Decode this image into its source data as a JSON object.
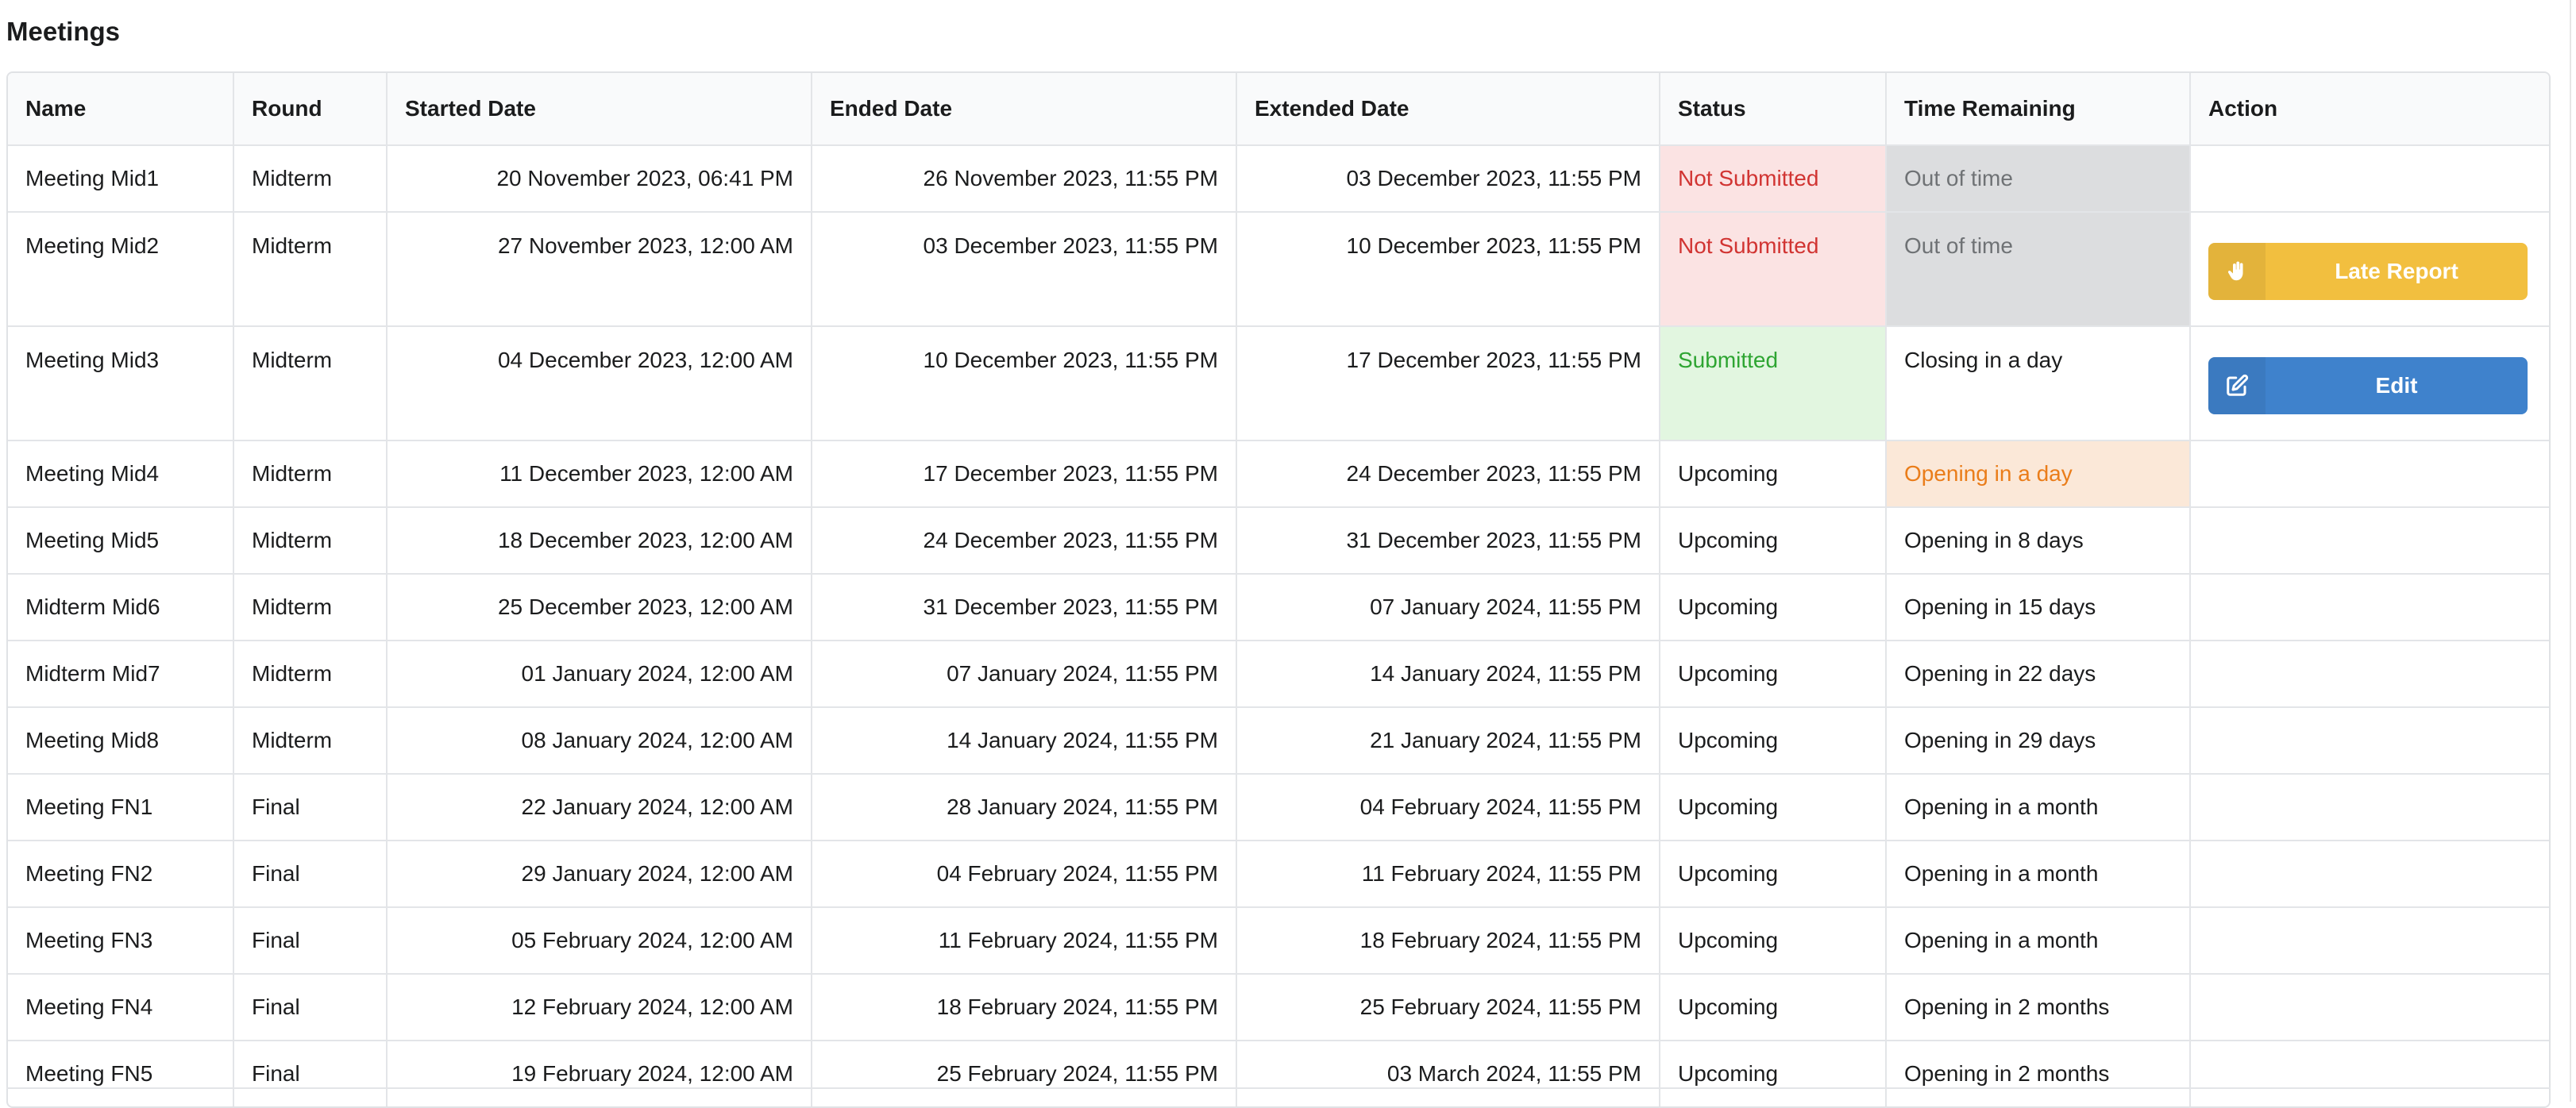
{
  "page": {
    "title": "Meetings"
  },
  "table": {
    "headers": [
      "Name",
      "Round",
      "Started Date",
      "Ended Date",
      "Extended Date",
      "Status",
      "Time Remaining",
      "Action"
    ],
    "rows": [
      {
        "name": "Meeting Mid1",
        "round": "Midterm",
        "started": "20 November 2023, 06:41 PM",
        "ended": "26 November 2023, 11:55 PM",
        "extended": "03 December 2023, 11:55 PM",
        "status": "Not Submitted",
        "time_remaining": "Out of time",
        "action": ""
      },
      {
        "name": "Meeting Mid2",
        "round": "Midterm",
        "started": "27 November 2023, 12:00 AM",
        "ended": "03 December 2023, 11:55 PM",
        "extended": "10 December 2023, 11:55 PM",
        "status": "Not Submitted",
        "time_remaining": "Out of time",
        "action": "Late Report"
      },
      {
        "name": "Meeting Mid3",
        "round": "Midterm",
        "started": "04 December 2023, 12:00 AM",
        "ended": "10 December 2023, 11:55 PM",
        "extended": "17 December 2023, 11:55 PM",
        "status": "Submitted",
        "time_remaining": "Closing in a day",
        "action": "Edit"
      },
      {
        "name": "Meeting Mid4",
        "round": "Midterm",
        "started": "11 December 2023, 12:00 AM",
        "ended": "17 December 2023, 11:55 PM",
        "extended": "24 December 2023, 11:55 PM",
        "status": "Upcoming",
        "time_remaining": "Opening in a day",
        "action": ""
      },
      {
        "name": "Meeting Mid5",
        "round": "Midterm",
        "started": "18 December 2023, 12:00 AM",
        "ended": "24 December 2023, 11:55 PM",
        "extended": "31 December 2023, 11:55 PM",
        "status": "Upcoming",
        "time_remaining": "Opening in 8 days",
        "action": ""
      },
      {
        "name": "Midterm Mid6",
        "round": "Midterm",
        "started": "25 December 2023, 12:00 AM",
        "ended": "31 December 2023, 11:55 PM",
        "extended": "07 January 2024, 11:55 PM",
        "status": "Upcoming",
        "time_remaining": "Opening in 15 days",
        "action": ""
      },
      {
        "name": "Midterm Mid7",
        "round": "Midterm",
        "started": "01 January 2024, 12:00 AM",
        "ended": "07 January 2024, 11:55 PM",
        "extended": "14 January 2024, 11:55 PM",
        "status": "Upcoming",
        "time_remaining": "Opening in 22 days",
        "action": ""
      },
      {
        "name": "Meeting Mid8",
        "round": "Midterm",
        "started": "08 January 2024, 12:00 AM",
        "ended": "14 January 2024, 11:55 PM",
        "extended": "21 January 2024, 11:55 PM",
        "status": "Upcoming",
        "time_remaining": "Opening in 29 days",
        "action": ""
      },
      {
        "name": "Meeting FN1",
        "round": "Final",
        "started": "22 January 2024, 12:00 AM",
        "ended": "28 January 2024, 11:55 PM",
        "extended": "04 February 2024, 11:55 PM",
        "status": "Upcoming",
        "time_remaining": "Opening in a month",
        "action": ""
      },
      {
        "name": "Meeting FN2",
        "round": "Final",
        "started": "29 January 2024, 12:00 AM",
        "ended": "04 February 2024, 11:55 PM",
        "extended": "11 February 2024, 11:55 PM",
        "status": "Upcoming",
        "time_remaining": "Opening in a month",
        "action": ""
      },
      {
        "name": "Meeting FN3",
        "round": "Final",
        "started": "05 February 2024, 12:00 AM",
        "ended": "11 February 2024, 11:55 PM",
        "extended": "18 February 2024, 11:55 PM",
        "status": "Upcoming",
        "time_remaining": "Opening in a month",
        "action": ""
      },
      {
        "name": "Meeting FN4",
        "round": "Final",
        "started": "12 February 2024, 12:00 AM",
        "ended": "18 February 2024, 11:55 PM",
        "extended": "25 February 2024, 11:55 PM",
        "status": "Upcoming",
        "time_remaining": "Opening in 2 months",
        "action": ""
      },
      {
        "name": "Meeting FN5",
        "round": "Final",
        "started": "19 February 2024, 12:00 AM",
        "ended": "25 February 2024, 11:55 PM",
        "extended": "03 March 2024, 11:55 PM",
        "status": "Upcoming",
        "time_remaining": "Opening in 2 months",
        "action": ""
      }
    ]
  },
  "buttons": {
    "late_report": {
      "label": "Late Report",
      "icon": "hand-icon",
      "color": "#f2bf3f"
    },
    "edit": {
      "label": "Edit",
      "icon": "edit-icon",
      "color": "#3f82cc"
    }
  },
  "colors": {
    "not_submitted_bg": "#fbe3e3",
    "not_submitted_text": "#d13432",
    "submitted_bg": "#e2f6e0",
    "submitted_text": "#2ea532",
    "out_of_time_bg": "#dcdddf",
    "opening_soon_bg": "#fbe8d8",
    "opening_soon_text": "#ea7d1a"
  }
}
